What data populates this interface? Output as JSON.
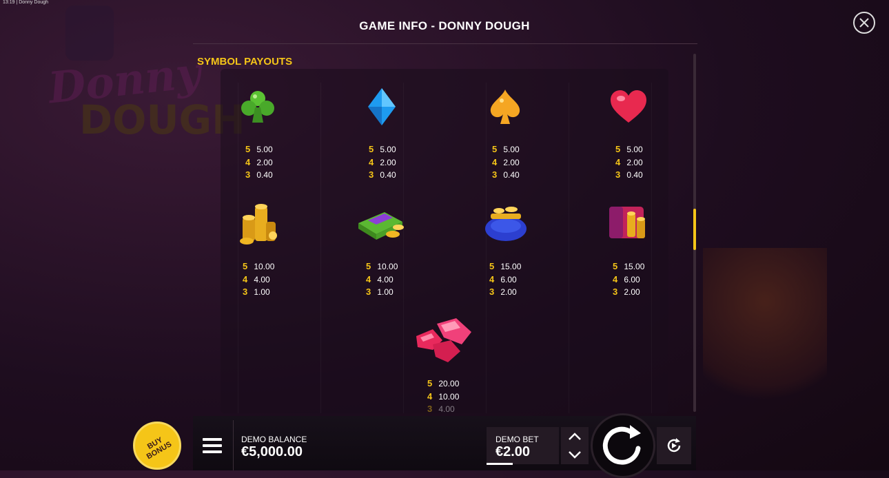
{
  "statusbar": {
    "time": "13:19",
    "app": "Donny Dough"
  },
  "background": {
    "logo_top": "Donny",
    "logo_bottom": "DOUGH"
  },
  "header": {
    "title": "GAME INFO - DONNY DOUGH",
    "close_icon": "close-icon"
  },
  "section": {
    "title": "SYMBOL PAYOUTS"
  },
  "symbols": [
    {
      "name": "club",
      "icon": "club-icon",
      "payouts": [
        {
          "k": "5",
          "v": "5.00"
        },
        {
          "k": "4",
          "v": "2.00"
        },
        {
          "k": "3",
          "v": "0.40"
        }
      ]
    },
    {
      "name": "diamond",
      "icon": "diamond-icon",
      "payouts": [
        {
          "k": "5",
          "v": "5.00"
        },
        {
          "k": "4",
          "v": "2.00"
        },
        {
          "k": "3",
          "v": "0.40"
        }
      ]
    },
    {
      "name": "spade",
      "icon": "spade-icon",
      "payouts": [
        {
          "k": "5",
          "v": "5.00"
        },
        {
          "k": "4",
          "v": "2.00"
        },
        {
          "k": "3",
          "v": "0.40"
        }
      ]
    },
    {
      "name": "heart",
      "icon": "heart-icon",
      "payouts": [
        {
          "k": "5",
          "v": "5.00"
        },
        {
          "k": "4",
          "v": "2.00"
        },
        {
          "k": "3",
          "v": "0.40"
        }
      ]
    },
    {
      "name": "coins",
      "icon": "coin-stack-icon",
      "payouts": [
        {
          "k": "5",
          "v": "10.00"
        },
        {
          "k": "4",
          "v": "4.00"
        },
        {
          "k": "3",
          "v": "1.00"
        }
      ]
    },
    {
      "name": "cash",
      "icon": "cash-stack-icon",
      "payouts": [
        {
          "k": "5",
          "v": "10.00"
        },
        {
          "k": "4",
          "v": "4.00"
        },
        {
          "k": "3",
          "v": "1.00"
        }
      ]
    },
    {
      "name": "purse",
      "icon": "coin-purse-icon",
      "payouts": [
        {
          "k": "5",
          "v": "15.00"
        },
        {
          "k": "4",
          "v": "6.00"
        },
        {
          "k": "3",
          "v": "2.00"
        }
      ]
    },
    {
      "name": "safe",
      "icon": "safe-icon",
      "payouts": [
        {
          "k": "5",
          "v": "15.00"
        },
        {
          "k": "4",
          "v": "6.00"
        },
        {
          "k": "3",
          "v": "2.00"
        }
      ]
    },
    {
      "name": "gems",
      "icon": "pink-gems-icon",
      "payouts": [
        {
          "k": "5",
          "v": "20.00"
        },
        {
          "k": "4",
          "v": "10.00"
        },
        {
          "k": "3",
          "v": "4.00"
        }
      ]
    }
  ],
  "controls": {
    "buy_bonus": "BUY BONUS",
    "menu_icon": "menu-icon",
    "balance_label": "DEMO BALANCE",
    "balance_value": "€5,000.00",
    "bet_label": "DEMO BET",
    "bet_value": "€2.00",
    "spin_icon": "spin-icon",
    "autoplay_icon": "autoplay-icon",
    "bet_up_icon": "chevron-up-icon",
    "bet_down_icon": "chevron-down-icon"
  },
  "colors": {
    "accent": "#f5c518",
    "panel": "#190c1c",
    "text": "#ffffff"
  }
}
